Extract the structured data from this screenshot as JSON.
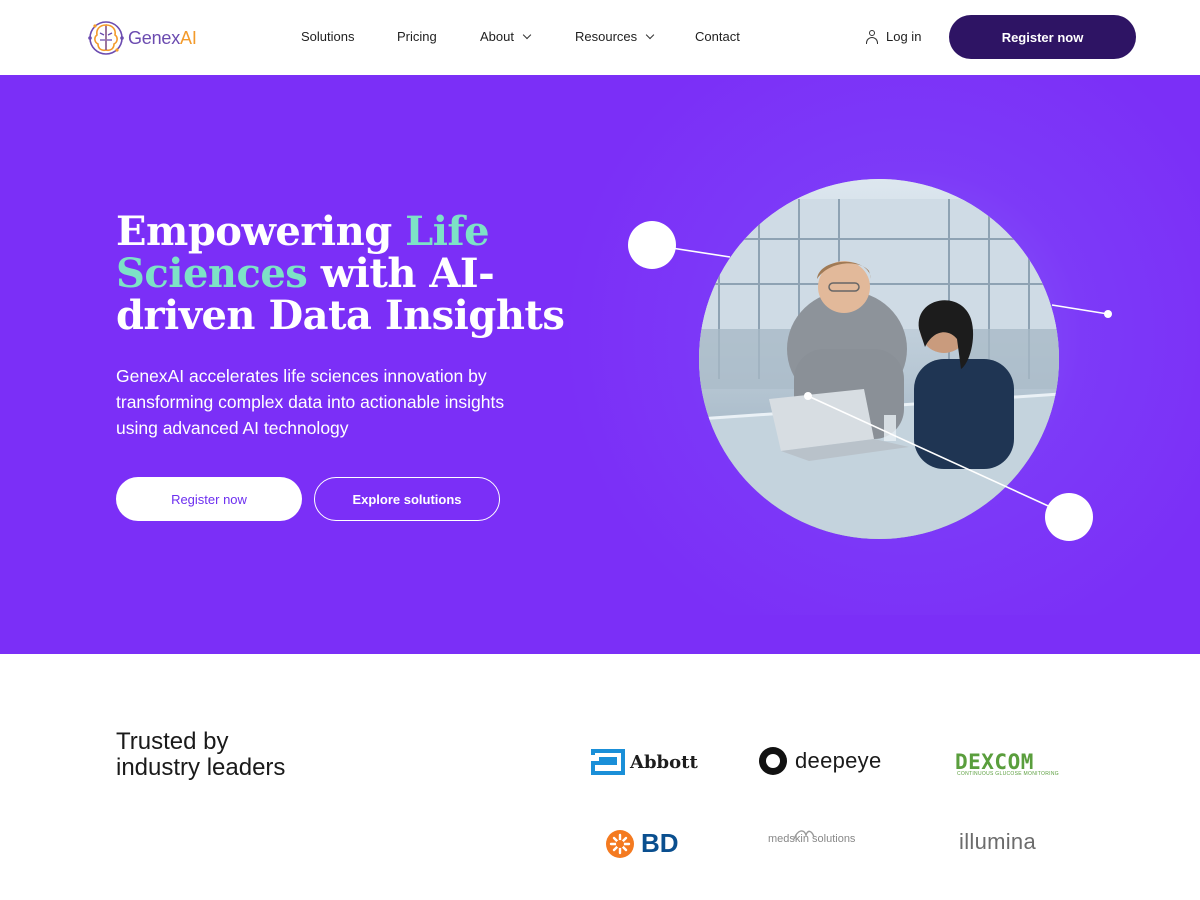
{
  "header": {
    "logo_text_main": "Genex",
    "logo_text_accent": "AI",
    "nav": [
      {
        "label": "Solutions",
        "has_dropdown": false
      },
      {
        "label": "Pricing",
        "has_dropdown": false
      },
      {
        "label": "About",
        "has_dropdown": true
      },
      {
        "label": "Resources",
        "has_dropdown": true
      },
      {
        "label": "Contact",
        "has_dropdown": false
      }
    ],
    "login_label": "Log in",
    "register_label": "Register now"
  },
  "hero": {
    "headline_part1": "Empowering ",
    "headline_accent1": "Life Sciences",
    "headline_part2": " with AI-driven Data Insights",
    "subtext": "GenexAI accelerates life sciences innovation by transforming complex data into actionable insights using advanced AI technology",
    "primary_button": "Register now",
    "secondary_button": "Explore solutions",
    "accent_color": "#7de2c6",
    "background_color": "#7b2ff7"
  },
  "trusted": {
    "heading_line1": "Trusted by",
    "heading_line2": "industry leaders",
    "logos": [
      {
        "name": "Abbott"
      },
      {
        "name": "deepeye"
      },
      {
        "name": "DEXCOM",
        "subtitle": "CONTINUOUS GLUCOSE MONITORING"
      },
      {
        "name": "BD"
      },
      {
        "name": "medskin solutions"
      },
      {
        "name": "illumina"
      }
    ]
  },
  "colors": {
    "brand_dark": "#2e1464",
    "brand_purple": "#7b2ff7"
  }
}
